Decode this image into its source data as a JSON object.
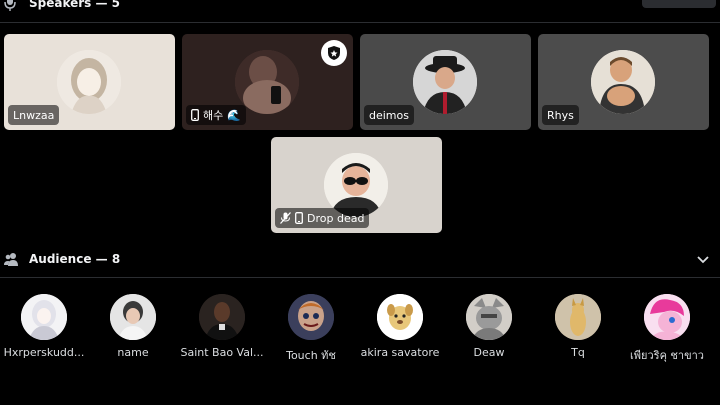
{
  "speakers": {
    "title": "Speakers — 5",
    "tiles": [
      {
        "name": "Lnwzaa"
      },
      {
        "name": "해수",
        "status_emoji": "🌊"
      },
      {
        "name": "deimos"
      },
      {
        "name": "Rhys"
      },
      {
        "name": "Drop dead"
      }
    ]
  },
  "audience": {
    "title": "Audience — 8",
    "members": [
      {
        "name": "Hxrperskudd..."
      },
      {
        "name": "name"
      },
      {
        "name": "Saint Bao Val..."
      },
      {
        "name": "Touch ทัช"
      },
      {
        "name": "akira savatore"
      },
      {
        "name": "Deaw"
      },
      {
        "name": "Tq"
      },
      {
        "name": "เพียวริคุ ชาขาว"
      }
    ]
  },
  "colors": {
    "background": "#000000",
    "tile_bg": "#e0dbd6",
    "divider": "#2b2d31"
  }
}
